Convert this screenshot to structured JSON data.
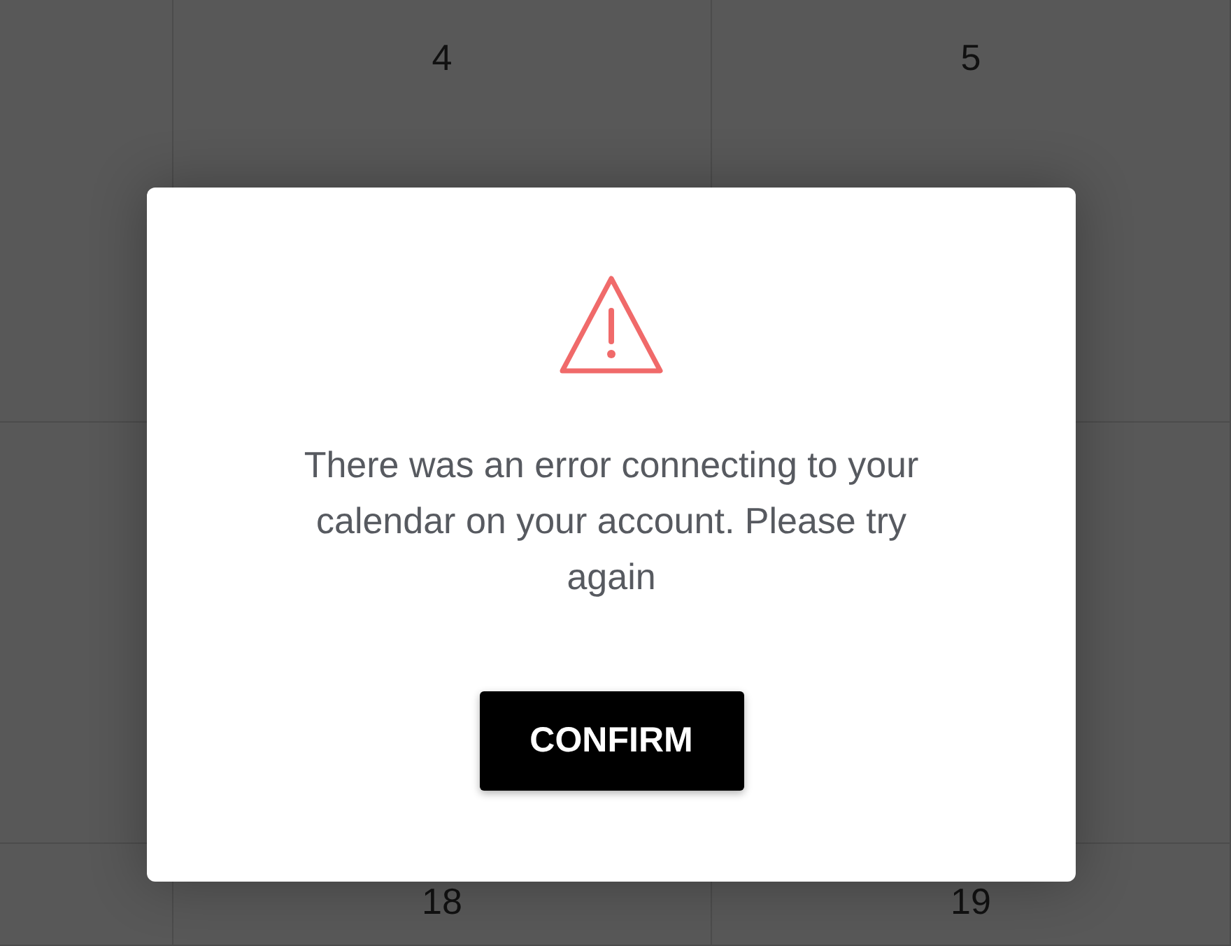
{
  "calendar": {
    "weeks": [
      {
        "days": [
          "4",
          "5"
        ]
      },
      {
        "days": [
          "18",
          "19"
        ]
      }
    ]
  },
  "dialog": {
    "message": "There was an error connecting to your calendar on your account. Please try again",
    "button": "CONFIRM"
  }
}
